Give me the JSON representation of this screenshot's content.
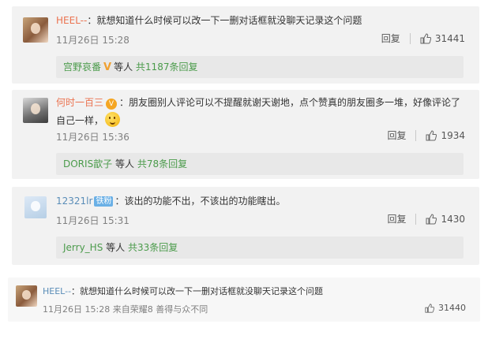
{
  "comments": [
    {
      "username": "HEEL--",
      "text": "：就想知道什么时候可以改一下一删对话框就没聊天记录这个问题",
      "timestamp": "11月26日 15:28",
      "reply_label": "回复",
      "likes": "31441",
      "sub_reply": {
        "users": "宫野哀番",
        "badge_icon": "V",
        "mid": "等人",
        "count": "共1187条回复"
      }
    },
    {
      "username": "何时一百三",
      "badge_icon": "V",
      "text_line1": "：朋友圈别人评论可以不提醒就谢天谢地，点个赞真的朋友圈多一堆，好像评论了",
      "text_line2": "自己一样，",
      "emoji": "smile-emoji",
      "timestamp": "11月26日 15:36",
      "reply_label": "回复",
      "likes": "1934",
      "sub_reply": {
        "users": "DORIS歆子",
        "mid": "等人",
        "count": "共78条回复"
      }
    },
    {
      "username": "12321lr",
      "badge": "铁粉",
      "text": "：该出的功能不出，不该出的功能瞎出。",
      "timestamp": "11月26日 15:31",
      "reply_label": "回复",
      "likes": "1430",
      "sub_reply": {
        "users": "Jerry_HS",
        "mid": "等人",
        "count": "共33条回复"
      }
    },
    {
      "username": "HEEL--",
      "text": "：就想知道什么时候可以改一下一删对话框就没聊天记录这个问题",
      "timestamp": "11月26日 15:28",
      "source": "来自荣耀8 善得与众不同",
      "likes": "31440"
    }
  ],
  "colors": {
    "name": "#eb7350",
    "reply_user": "#4b9b4b",
    "card_bg": "#f2f2f2"
  }
}
